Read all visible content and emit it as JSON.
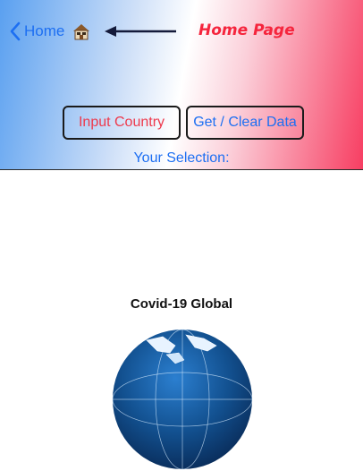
{
  "nav": {
    "back_label": "Home",
    "home_icon": "house-icon",
    "arrow_icon": "arrow-left-icon",
    "home_page_label": "Home Page"
  },
  "toolbar": {
    "input_country_label": "Input Country",
    "get_clear_label": "Get / Clear Data"
  },
  "selection": {
    "label": "Your Selection:"
  },
  "globe": {
    "title": "Covid-19 Global",
    "icon": "globe-icon"
  },
  "colors": {
    "accent_blue": "#1d6ff2",
    "accent_red": "#f5253d",
    "gradient_left": "#5aa0f0",
    "gradient_right": "#f73e62"
  }
}
